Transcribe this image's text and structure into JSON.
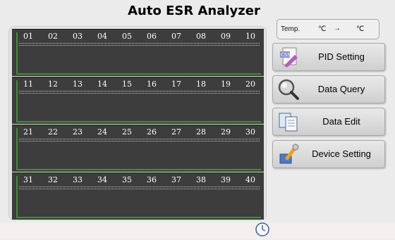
{
  "title": "Auto ESR Analyzer",
  "channels": {
    "rows": [
      [
        "01",
        "02",
        "03",
        "04",
        "05",
        "06",
        "07",
        "08",
        "09",
        "10"
      ],
      [
        "11",
        "12",
        "13",
        "14",
        "15",
        "16",
        "17",
        "18",
        "19",
        "20"
      ],
      [
        "21",
        "22",
        "23",
        "24",
        "25",
        "26",
        "27",
        "28",
        "29",
        "30"
      ],
      [
        "31",
        "32",
        "33",
        "34",
        "35",
        "36",
        "37",
        "38",
        "39",
        "40"
      ]
    ]
  },
  "temperature": {
    "label": "Temp.",
    "current_unit": "℃",
    "arrow": "→",
    "target_unit": "℃"
  },
  "menu": {
    "pid_setting": "PID Setting",
    "data_query": "Data Query",
    "data_edit": "Data Edit",
    "device_setting": "Device Setting"
  },
  "colors": {
    "panel_dark": "#3d3d3d",
    "trace_green": "#3f8f2f",
    "background": "#ebebeb"
  },
  "icons": [
    "css-file-icon",
    "magnifier-icon",
    "documents-icon",
    "wrench-icon",
    "clock-icon"
  ]
}
